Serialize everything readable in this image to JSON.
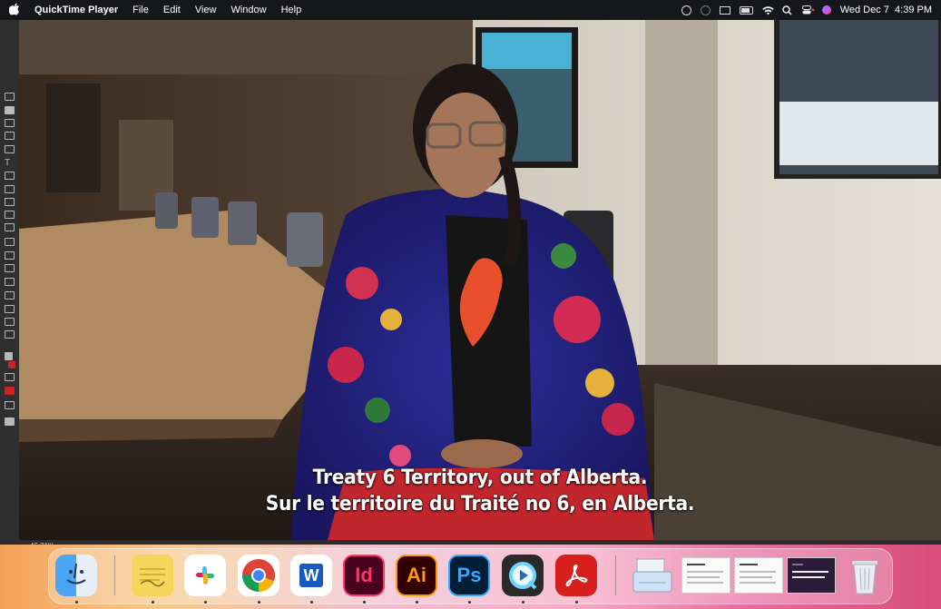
{
  "menubar": {
    "app_name": "QuickTime Player",
    "menus": [
      "File",
      "Edit",
      "View",
      "Window",
      "Help"
    ],
    "datetime": "Wed Dec 7  4:39 PM"
  },
  "video": {
    "captions": [
      "Treaty 6 Territory, out of Alberta.",
      "Sur le territoire du Traité no 6, en Alberta."
    ]
  },
  "statusbar": {
    "zoom": "46.31%"
  },
  "dock": {
    "apps": [
      {
        "name": "finder-icon",
        "label": "",
        "bg": "#3d8fe8",
        "fg": "#ffffff"
      },
      {
        "name": "stickies-icon",
        "label": "",
        "bg": "#f5d55a",
        "fg": "#c8a437"
      },
      {
        "name": "slack-icon",
        "label": "",
        "bg": "#ffffff",
        "fg": "#4a154b"
      },
      {
        "name": "chrome-icon",
        "label": "",
        "bg": "#ffffff",
        "fg": "#4285f4"
      },
      {
        "name": "word-icon",
        "label": "W",
        "bg": "#ffffff",
        "fg": "#185abd"
      },
      {
        "name": "indesign-icon",
        "label": "Id",
        "bg": "#49021f",
        "fg": "#ff3366"
      },
      {
        "name": "illustrator-icon",
        "label": "Ai",
        "bg": "#330000",
        "fg": "#ff9a00"
      },
      {
        "name": "photoshop-icon",
        "label": "Ps",
        "bg": "#001e36",
        "fg": "#31a8ff"
      },
      {
        "name": "quicktime-icon",
        "label": "",
        "bg": "#2a2a2a",
        "fg": "#6fd3ff"
      },
      {
        "name": "acrobat-icon",
        "label": "",
        "bg": "#d7201c",
        "fg": "#ffffff"
      }
    ]
  }
}
